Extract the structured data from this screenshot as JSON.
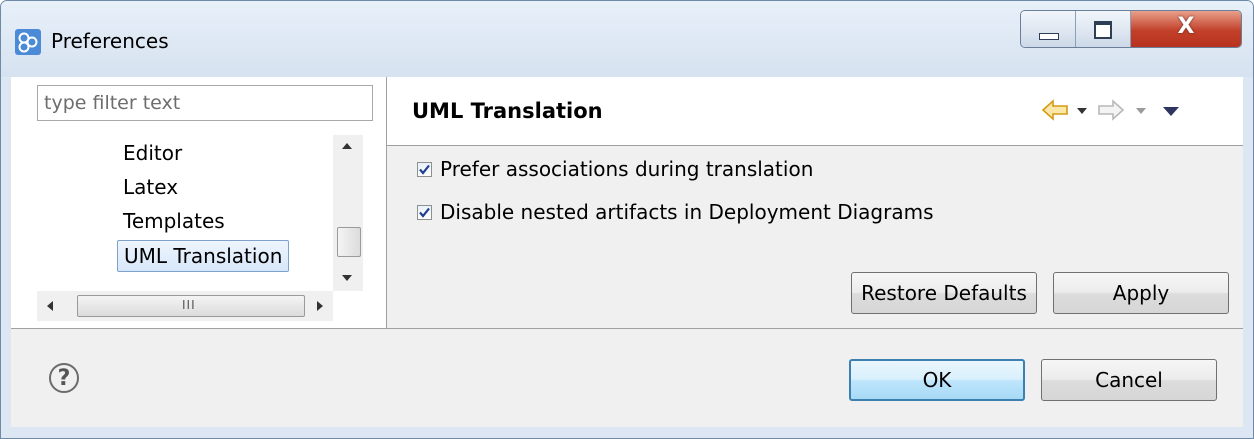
{
  "window": {
    "title": "Preferences",
    "close_glyph": "X"
  },
  "sidebar": {
    "filter_placeholder": "type filter text",
    "items": [
      {
        "label": "Editor"
      },
      {
        "label": "Latex"
      },
      {
        "label": "Templates"
      },
      {
        "label": "UML Translation",
        "selected": true
      }
    ],
    "hscroll_grip": "III"
  },
  "page": {
    "title": "UML Translation",
    "options": [
      {
        "label": "Prefer associations during translation",
        "checked": true
      },
      {
        "label": "Disable nested artifacts in Deployment Diagrams",
        "checked": true
      }
    ],
    "restore_defaults_label": "Restore Defaults",
    "apply_label": "Apply"
  },
  "footer": {
    "help_glyph": "?",
    "ok_label": "OK",
    "cancel_label": "Cancel"
  },
  "colors": {
    "selection_border": "#7da2ce",
    "default_button_border": "#3c7fb1",
    "close_button": "#c2402a",
    "back_arrow": "#f0b020"
  }
}
